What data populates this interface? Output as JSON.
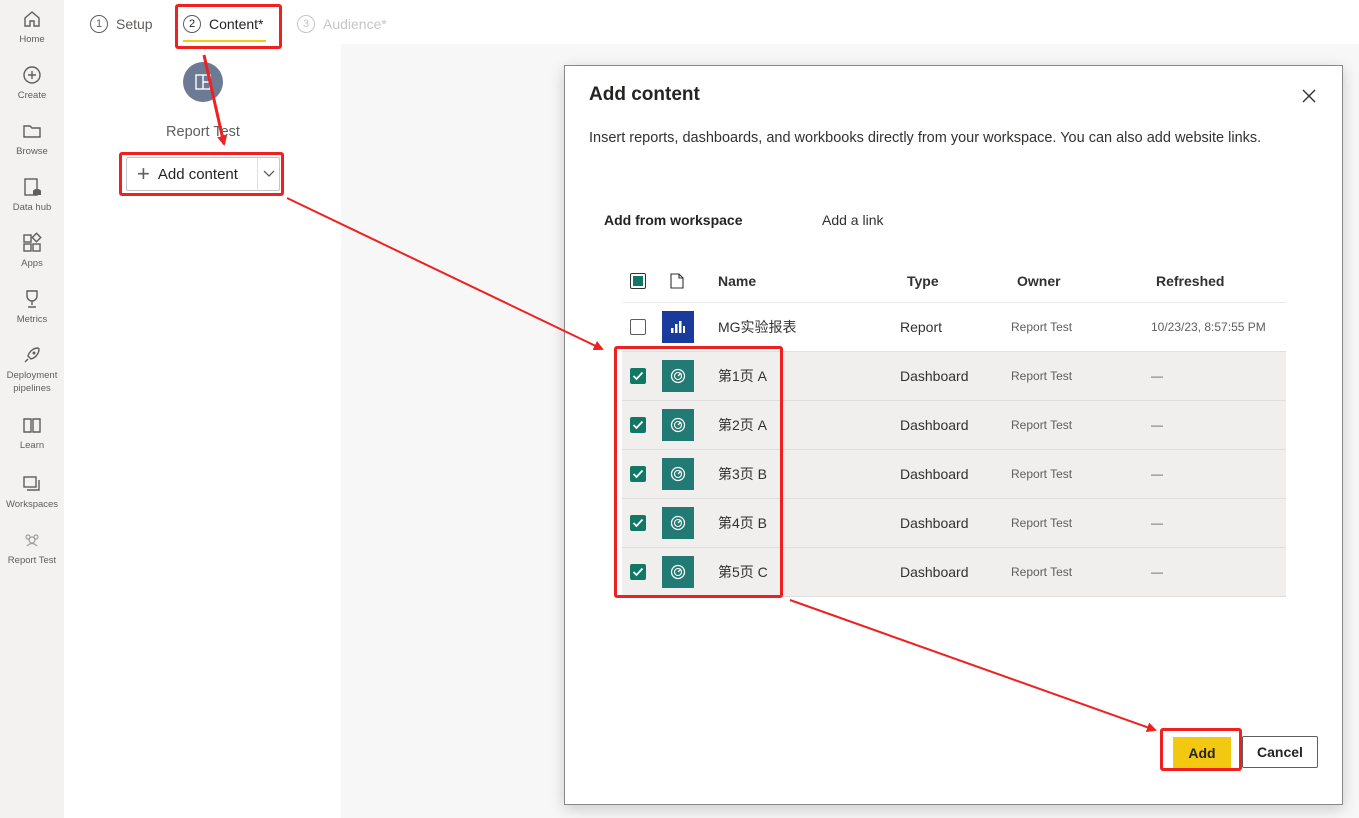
{
  "nav": {
    "items": [
      {
        "label": "Home",
        "icon": "home-icon"
      },
      {
        "label": "Create",
        "icon": "plus-circle-icon"
      },
      {
        "label": "Browse",
        "icon": "folder-icon"
      },
      {
        "label": "Data hub",
        "icon": "database-icon"
      },
      {
        "label": "Apps",
        "icon": "apps-icon"
      },
      {
        "label": "Metrics",
        "icon": "trophy-icon"
      },
      {
        "label": "Deployment pipelines",
        "icon": "rocket-icon"
      },
      {
        "label": "Learn",
        "icon": "book-icon"
      },
      {
        "label": "Workspaces",
        "icon": "workspaces-icon"
      },
      {
        "label": "Report Test",
        "icon": "workspace-avatar-icon"
      }
    ]
  },
  "steps": [
    {
      "num": "1",
      "label": "Setup"
    },
    {
      "num": "2",
      "label": "Content*"
    },
    {
      "num": "3",
      "label": "Audience*"
    }
  ],
  "app": {
    "name": "Report Test",
    "add_content_label": "Add content"
  },
  "dialog": {
    "title": "Add content",
    "description": "Insert reports, dashboards, and workbooks directly from your workspace. You can also add website links.",
    "tabs": [
      "Add from workspace",
      "Add a link"
    ],
    "columns": {
      "name": "Name",
      "type": "Type",
      "owner": "Owner",
      "refreshed": "Refreshed"
    },
    "rows": [
      {
        "name": "MG实验报表",
        "type": "Report",
        "owner": "Report Test",
        "refreshed": "10/23/23, 8:57:55 PM",
        "kind": "report",
        "checked": false
      },
      {
        "name": "第1页 A",
        "type": "Dashboard",
        "owner": "Report Test",
        "refreshed": "—",
        "kind": "dashboard",
        "checked": true
      },
      {
        "name": "第2页 A",
        "type": "Dashboard",
        "owner": "Report Test",
        "refreshed": "—",
        "kind": "dashboard",
        "checked": true
      },
      {
        "name": "第3页 B",
        "type": "Dashboard",
        "owner": "Report Test",
        "refreshed": "—",
        "kind": "dashboard",
        "checked": true
      },
      {
        "name": "第4页 B",
        "type": "Dashboard",
        "owner": "Report Test",
        "refreshed": "—",
        "kind": "dashboard",
        "checked": true
      },
      {
        "name": "第5页 C",
        "type": "Dashboard",
        "owner": "Report Test",
        "refreshed": "—",
        "kind": "dashboard",
        "checked": true
      }
    ],
    "add_label": "Add",
    "cancel_label": "Cancel"
  },
  "colors": {
    "accent_yellow": "#f2c811",
    "check_green": "#117865",
    "report_icon_bg": "#1a3a9c",
    "dashboard_icon_bg": "#217a73",
    "annotation_red": "#ee2020"
  }
}
